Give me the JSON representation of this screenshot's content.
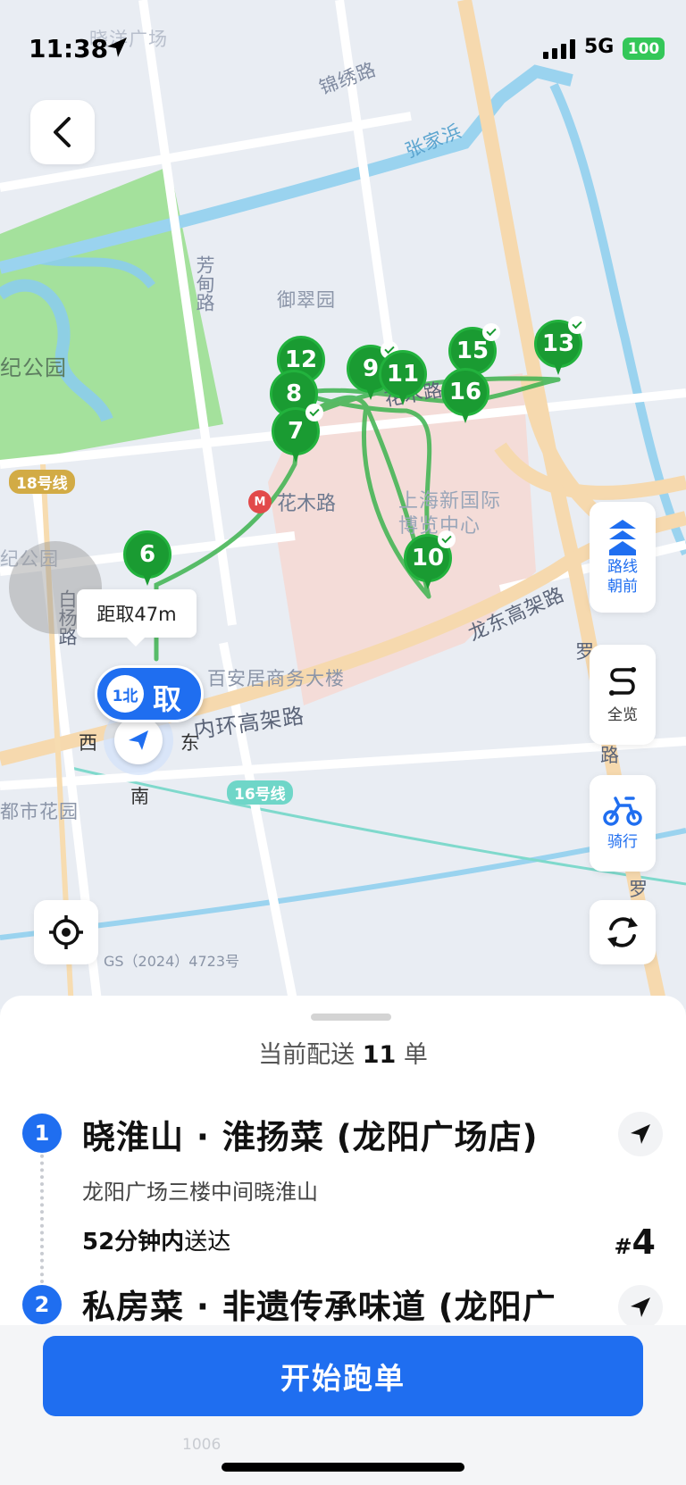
{
  "status_bar": {
    "time": "11:38",
    "network": "5G",
    "battery": "100"
  },
  "map": {
    "labels": {
      "jinxiu_road": "锦绣路",
      "zhangjiabang": "张家浜",
      "fangdian_road": "芳甸路",
      "yucui_garden": "御翠园",
      "century_park": "纪公园",
      "century_park_2": "纪公园",
      "huamu_road": "花木路",
      "metro_station": "花木路",
      "expo_center": "上海新国际博览中心",
      "longdong_elevated": "龙东高架路",
      "baiyang_road": "白杨路",
      "baian_building": "百安居商务大楼",
      "inner_ring": "内环高架路",
      "dushi_garden": "都市花园",
      "luo_road": "罗",
      "luo_road_2": "路",
      "luo_road_3": "罗",
      "top_faded": "晓洋广场",
      "line18": "18号线",
      "line16": "16号线",
      "gs_number": "GS（2024）4723号"
    },
    "markers": [
      {
        "number": "12",
        "done": false
      },
      {
        "number": "8",
        "done": false
      },
      {
        "number": "7",
        "done": true
      },
      {
        "number": "9",
        "done": true
      },
      {
        "number": "11",
        "done": false
      },
      {
        "number": "15",
        "done": true
      },
      {
        "number": "16",
        "done": false
      },
      {
        "number": "13",
        "done": true
      },
      {
        "number": "6",
        "done": false
      },
      {
        "number": "10",
        "done": true
      }
    ],
    "distance_tip": "距取47m",
    "pickup": {
      "mini": "1北",
      "label": "取"
    },
    "compass": {
      "west": "西",
      "east": "东",
      "south": "南"
    },
    "colors": {
      "route": "#3db34f",
      "marker": "#1a9b32",
      "accent": "#1f6ef0"
    }
  },
  "tools": {
    "route_heading": [
      "路线",
      "朝前"
    ],
    "overview": "全览",
    "riding": "骑行"
  },
  "sheet": {
    "title_prefix": "当前配送",
    "count": "11",
    "title_suffix": "单",
    "orders": [
      {
        "index": "1",
        "name": "晓淮山 · 淮扬菜 (龙阳广场店)",
        "address": "龙阳广场三楼中间晓淮山",
        "time_bold": "52分钟内",
        "time_rest": "送达",
        "seq_prefix": "#",
        "seq": "4"
      },
      {
        "index": "2",
        "name": "私房菜 · 非遗传承味道 (龙阳广"
      }
    ]
  },
  "action": {
    "start_label": "开始跑单",
    "ghost": "1006"
  }
}
